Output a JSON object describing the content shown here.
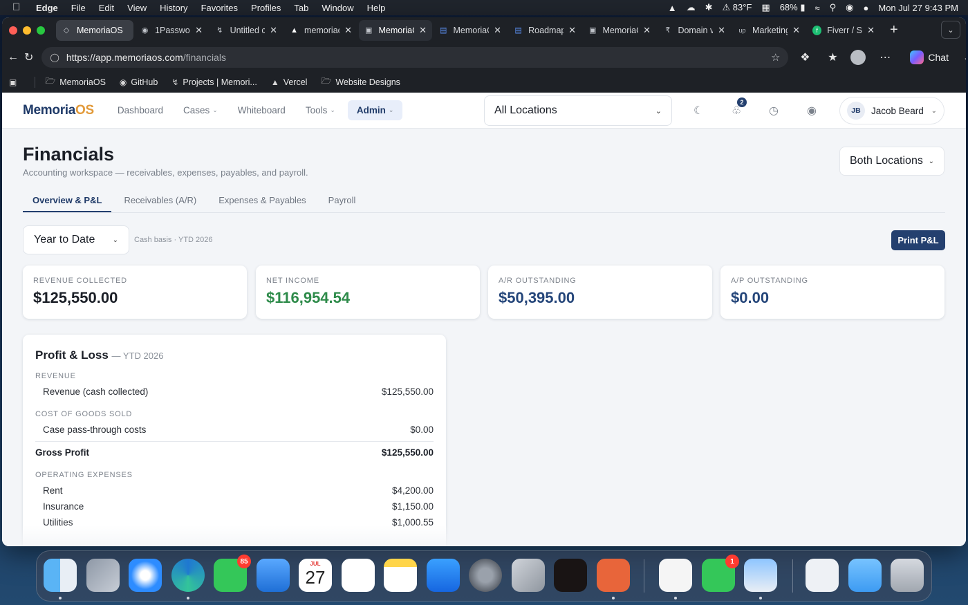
{
  "menubar": {
    "app": "Edge",
    "items": [
      "File",
      "Edit",
      "View",
      "History",
      "Favorites",
      "Profiles",
      "Tab",
      "Window",
      "Help"
    ],
    "weather": "83°F",
    "battery": "68%",
    "datetime": "Mon Jul 27  9:43 PM"
  },
  "browser": {
    "tabs": [
      {
        "label": "MemoriaOS",
        "icon": "memoria-icon"
      },
      {
        "label": "1Passwor",
        "icon": "onepassword-icon"
      },
      {
        "label": "Untitled c",
        "icon": "bolt-icon"
      },
      {
        "label": "memoriac",
        "icon": "vercel-icon"
      },
      {
        "label": "MemoriaC",
        "icon": "book-icon"
      },
      {
        "label": "MemoriaC",
        "icon": "doc-icon"
      },
      {
        "label": "Roadmap",
        "icon": "doc-icon"
      },
      {
        "label": "MemoriaC",
        "icon": "book-icon"
      },
      {
        "label": "Domain v",
        "icon": "rupee-icon"
      },
      {
        "label": "Marketing",
        "icon": "upwork-icon"
      },
      {
        "label": "Fiverr / Sl",
        "icon": "fiverr-icon"
      }
    ],
    "url_host": "https://app.memoriaos.com",
    "url_path": "/financials",
    "chat_label": "Chat"
  },
  "bookmarks": [
    {
      "label": "MemoriaOS",
      "icon": "folder-icon"
    },
    {
      "label": "GitHub",
      "icon": "github-icon"
    },
    {
      "label": "Projects | Memori...",
      "icon": "bolt-icon"
    },
    {
      "label": "Vercel",
      "icon": "vercel-icon"
    },
    {
      "label": "Website Designs",
      "icon": "folder-icon"
    }
  ],
  "app": {
    "brand_main": "Memoria",
    "brand_accent": "OS",
    "nav": [
      "Dashboard",
      "Cases",
      "Whiteboard",
      "Tools",
      "Admin"
    ],
    "location_select": "All Locations",
    "notifications_count": "2",
    "user_initials": "JB",
    "user_name": "Jacob Beard"
  },
  "page": {
    "title": "Financials",
    "subtitle": "Accounting workspace — receivables, expenses, payables, and payroll.",
    "location_filter": "Both Locations",
    "tabs": [
      "Overview & P&L",
      "Receivables (A/R)",
      "Expenses & Payables",
      "Payroll"
    ],
    "range": "Year to Date",
    "basis_note": "Cash basis · YTD 2026",
    "print_label": "Print P&L"
  },
  "kpis": [
    {
      "label": "REVENUE COLLECTED",
      "value": "$125,550.00",
      "color": "#1b1f27"
    },
    {
      "label": "NET INCOME",
      "value": "$116,954.54",
      "color": "#2e8b4a"
    },
    {
      "label": "A/R OUTSTANDING",
      "value": "$50,395.00",
      "color": "#25467a"
    },
    {
      "label": "A/P OUTSTANDING",
      "value": "$0.00",
      "color": "#25467a"
    }
  ],
  "pl": {
    "title": "Profit & Loss",
    "period": "— YTD 2026",
    "revenue_header": "REVENUE",
    "revenue_rows": [
      {
        "label": "Revenue (cash collected)",
        "value": "$125,550.00"
      }
    ],
    "cogs_header": "COST OF GOODS SOLD",
    "cogs_rows": [
      {
        "label": "Case pass-through costs",
        "value": "$0.00"
      }
    ],
    "gross_label": "Gross Profit",
    "gross_value": "$125,550.00",
    "opex_header": "OPERATING EXPENSES",
    "opex_rows": [
      {
        "label": "Rent",
        "value": "$4,200.00"
      },
      {
        "label": "Insurance",
        "value": "$1,150.00"
      },
      {
        "label": "Utilities",
        "value": "$1,000.55"
      }
    ]
  },
  "dock": {
    "messages_badge": "85",
    "facetime_badge": "1",
    "calendar_month": "JUL",
    "calendar_day": "27",
    "icons": [
      "finder-icon",
      "launchpad-icon",
      "safari-icon",
      "edge-icon",
      "messages-icon",
      "testflight-icon",
      "calendar-icon",
      "reminders-icon",
      "notes-icon",
      "appstore-icon",
      "settings-icon",
      "iphone-mirroring-icon",
      "spotify-icon",
      "claude-icon",
      "textedit-icon",
      "facetime-icon",
      "preview-icon",
      "downloads-icon",
      "folder-icon",
      "trash-icon"
    ]
  },
  "colors": {
    "brand": "#1f3a68",
    "accent": "#e29a3a",
    "primary_button": "#24406f",
    "positive": "#2e8b4a"
  }
}
